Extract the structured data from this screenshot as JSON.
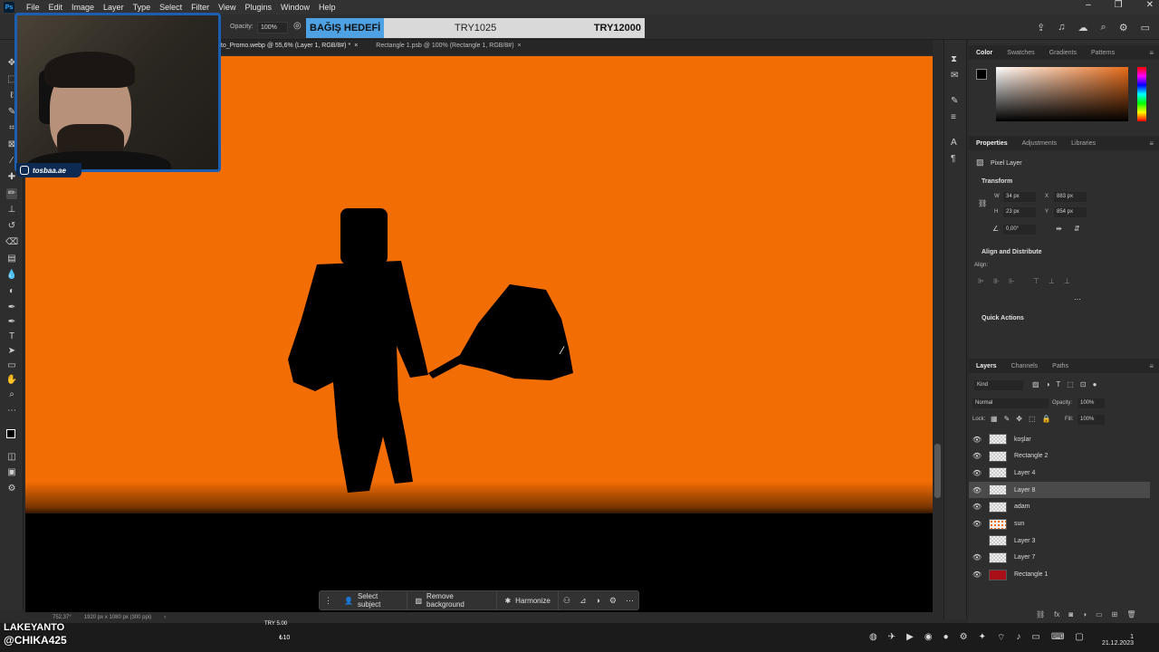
{
  "app": {
    "name": "Ps",
    "menu": [
      "File",
      "Edit",
      "Image",
      "Layer",
      "Type",
      "Select",
      "Filter",
      "View",
      "Plugins",
      "Window",
      "Help"
    ]
  },
  "options": {
    "opacity_label": "Opacity:",
    "opacity_value": "100%"
  },
  "donation": {
    "title": "BAĞIŞ HEDEFİ",
    "current": "TRY1025",
    "goal": "TRY12000"
  },
  "tabs": [
    {
      "label": "oto_Promo.webp @ 55,6% (Layer 1, RGB/8#) *",
      "close": "×"
    },
    {
      "label": "Rectangle 1.psb @ 100% (Rectangle 1, RGB/8#)",
      "close": "×"
    }
  ],
  "webcam": {
    "handle": "tosbaa.ae"
  },
  "contextbar": {
    "select_subject": "Select subject",
    "remove_background": "Remove background",
    "harmonize": "Harmonize"
  },
  "status": {
    "zoom": "752,37°",
    "doc_size": "1920 px x 1080 px (300 ppi)"
  },
  "color_panel": {
    "tabs": [
      "Color",
      "Swatches",
      "Gradients",
      "Patterns"
    ]
  },
  "properties_panel": {
    "tabs": [
      "Properties",
      "Adjustments",
      "Libraries"
    ],
    "layer_type": "Pixel Layer",
    "transform_label": "Transform",
    "w_label": "W",
    "w_value": "34 px",
    "h_label": "H",
    "h_value": "23 px",
    "x_label": "X",
    "x_value": "883 px",
    "y_label": "Y",
    "y_value": "854 px",
    "angle_value": "0,00°",
    "align_label": "Align and Distribute",
    "align_sub": "Align:",
    "quick_actions": "Quick Actions"
  },
  "layers_panel": {
    "tabs": [
      "Layers",
      "Channels",
      "Paths"
    ],
    "filter_kind": "Kind",
    "blend_mode": "Normal",
    "opacity_label": "Opacity:",
    "opacity_value": "100%",
    "lock_label": "Lock:",
    "fill_label": "Fill:",
    "fill_value": "100%",
    "layers": [
      {
        "name": "koşlar",
        "visible": true,
        "selected": false
      },
      {
        "name": "Rectangle 2",
        "visible": true,
        "selected": false
      },
      {
        "name": "Layer 4",
        "visible": true,
        "selected": false
      },
      {
        "name": "Layer 8",
        "visible": true,
        "selected": true
      },
      {
        "name": "adam",
        "visible": true,
        "selected": false
      },
      {
        "name": "sun",
        "visible": true,
        "selected": false
      },
      {
        "name": "Layer 3",
        "visible": false,
        "selected": false
      },
      {
        "name": "Layer 7",
        "visible": true,
        "selected": false
      },
      {
        "name": "Rectangle 1",
        "visible": true,
        "selected": false
      }
    ]
  },
  "stream_overlay": {
    "name": "LAKEYANTO",
    "handle": "@CHIKA425",
    "tts_top": "TRY 5.00",
    "tts_amount": "₺10"
  },
  "taskbar": {
    "time": "1",
    "date": "21.12.2023"
  }
}
